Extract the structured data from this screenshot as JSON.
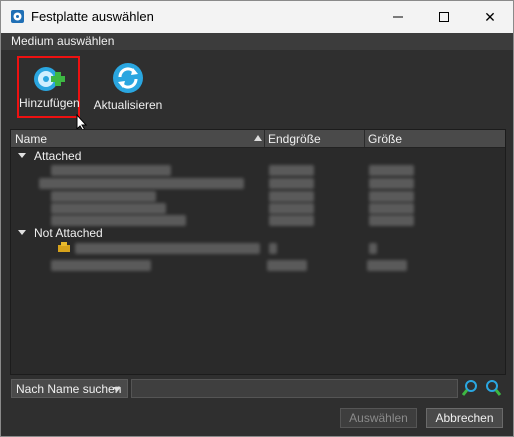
{
  "window": {
    "title": "Festplatte auswählen",
    "close_glyph": "✕"
  },
  "menubar": {
    "label": "Medium auswählen"
  },
  "toolbar": {
    "add_label": "Hinzufügen",
    "refresh_label": "Aktualisieren"
  },
  "table": {
    "columns": [
      "Name",
      "Endgröße",
      "Größe"
    ],
    "groups": {
      "attached": "Attached",
      "not_attached": "Not Attached"
    }
  },
  "search": {
    "mode_label": "Nach Name suchen",
    "value": ""
  },
  "buttons": {
    "select": "Auswählen",
    "cancel": "Abbrechen"
  },
  "colors": {
    "highlight_border": "#ee1111",
    "accent_blue": "#2aa6e0",
    "accent_green": "#3db843"
  }
}
